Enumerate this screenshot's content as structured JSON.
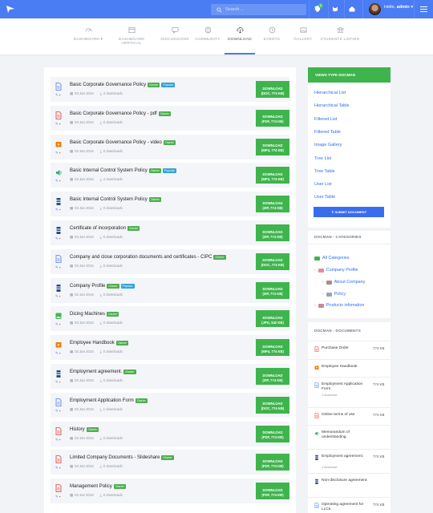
{
  "header": {
    "search_placeholder": "Search ...",
    "notification_count": "1",
    "greeting": "Hello,",
    "username": "admin"
  },
  "nav": [
    {
      "label": "DASHBOARD",
      "icon": "speedometer-icon",
      "active": false
    },
    {
      "label": "DASHBOARD VERTICAL",
      "icon": "layout-icon",
      "active": false
    },
    {
      "label": "DISCUSSIONS",
      "icon": "chat-icon",
      "active": false
    },
    {
      "label": "COMMUNITY",
      "icon": "globe-icon",
      "active": false
    },
    {
      "label": "DOWNLOAD",
      "icon": "cloud-download-icon",
      "active": true
    },
    {
      "label": "EVENTS",
      "icon": "clock-icon",
      "active": false
    },
    {
      "label": "GALLERY",
      "icon": "gallery-icon",
      "active": false
    },
    {
      "label": "STUDENTS LISTING",
      "icon": "bank-icon",
      "active": false
    }
  ],
  "documents": [
    {
      "title": "Basic Corporate Governance Policy",
      "tags": [
        "Owner",
        "Popular"
      ],
      "date": "03 Jan 2016",
      "downloads": "3 downloads",
      "button": [
        "DOWNLOAD",
        "(DOC, 774 KB)"
      ],
      "icon": "doc-icon"
    },
    {
      "title": "Basic Corporate Governance Policy - pdf",
      "tags": [
        "Owner"
      ],
      "date": "03 Jan 2016",
      "downloads": "0 downloads",
      "button": [
        "DOWNLOAD",
        "(PDF, 774 KB)"
      ],
      "icon": "pdf-icon"
    },
    {
      "title": "Basic Corporate Governance Policy - video",
      "tags": [
        "Owner"
      ],
      "date": "03 Jan 2016",
      "downloads": "0 downloads",
      "button": [
        "DOWNLOAD",
        "(MP4, 774 KB)"
      ],
      "icon": "video-icon"
    },
    {
      "title": "Basic Internal Control System Policy",
      "tags": [
        "Owner",
        "Popular"
      ],
      "date": "03 Jan 2016",
      "downloads": "4 downloads",
      "button": [
        "DOWNLOAD",
        "(MP3, 774 KB)"
      ],
      "icon": "audio-icon"
    },
    {
      "title": "Basic Internal Control System Policy",
      "tags": [
        "Owner"
      ],
      "date": "03 Jan 2016",
      "downloads": "0 downloads",
      "button": [
        "DOWNLOAD",
        "(ZIP, 774 KB)"
      ],
      "icon": "zip-icon"
    },
    {
      "title": "Certificate of incorporation",
      "tags": [
        "Owner"
      ],
      "date": "03 Jan 2016",
      "downloads": "0 downloads",
      "button": [
        "DOWNLOAD",
        "(ZIP, 774 KB)"
      ],
      "icon": "zip-icon"
    },
    {
      "title": "Company and close corporation documents and certificates - CIPC",
      "tags": [
        "Owner"
      ],
      "date": "03 Jan 2016",
      "downloads": "0 downloads",
      "button": [
        "DOWNLOAD",
        "(DOC, 774 KB)"
      ],
      "icon": "doc-icon"
    },
    {
      "title": "Company Profile",
      "tags": [
        "Owner",
        "Popular"
      ],
      "date": "03 Jan 2016",
      "downloads": "0 downloads",
      "button": [
        "DOWNLOAD",
        "(ZIP, 774 KB)"
      ],
      "icon": "zip-icon"
    },
    {
      "title": "Dicing Machines",
      "tags": [
        "Owner"
      ],
      "date": "03 Jan 2016",
      "downloads": "0 downloads",
      "button": [
        "DOWNLOAD",
        "(JPG, 542 KB)"
      ],
      "icon": "image-icon"
    },
    {
      "title": "Employee Handbook",
      "tags": [
        "Owner"
      ],
      "date": "03 Jan 2016",
      "downloads": "0 downloads",
      "button": [
        "DOWNLOAD",
        "(MP4, 774 KB)"
      ],
      "icon": "video-icon"
    },
    {
      "title": "Employment agreement.",
      "tags": [
        "Owner"
      ],
      "date": "03 Jan 2016",
      "downloads": "0 downloads",
      "button": [
        "DOWNLOAD",
        "(ZIP, 774 KB)"
      ],
      "icon": "zip-icon"
    },
    {
      "title": "Employment Application Form",
      "tags": [
        "Owner"
      ],
      "date": "03 Jan 2016",
      "downloads": "1 downloads",
      "button": [
        "DOWNLOAD",
        "(DOC, 774 KB)"
      ],
      "icon": "doc-icon"
    },
    {
      "title": "History",
      "tags": [
        "Owner"
      ],
      "date": "03 Jan 2016",
      "downloads": "0 downloads",
      "button": [
        "DOWNLOAD",
        "(PDF, 774 KB)"
      ],
      "icon": "pdf-icon"
    },
    {
      "title": "Limited Company Documents - Slideshare",
      "tags": [
        "Owner"
      ],
      "date": "03 Jan 2016",
      "downloads": "0 downloads",
      "button": [
        "DOWNLOAD",
        "(PDF, 774 KB)"
      ],
      "icon": "pdf-icon"
    },
    {
      "title": "Management Policy",
      "tags": [
        "Owner"
      ],
      "date": "03 Jan 2016",
      "downloads": "0 downloads",
      "button": [
        "DOWNLOAD",
        "(PDF, 774 KB)"
      ],
      "icon": "pdf-icon"
    }
  ],
  "views_box": {
    "title": "VIEWS TYPE DOCMAN",
    "links": [
      "Hierarchical List",
      "Hierarchical Table",
      "Filtered List",
      "Filtered Table",
      "Image Gallery",
      "Tree List",
      "Tree Table",
      "User List",
      "User Table"
    ],
    "submit_label": "SUBMIT DOCUMENT"
  },
  "categories_box": {
    "title": "DOCMAN - CATEGORIES",
    "items": [
      "All Categories",
      "Company Profile",
      "About Company",
      "Policy",
      "Products infomation"
    ]
  },
  "documents_box": {
    "title": "DOCMAN - DOCUMENTS",
    "items": [
      {
        "name": "Purchase Order",
        "size": "774 KB",
        "downloads": "",
        "icon": "pdf-icon"
      },
      {
        "name": "Employee Handbook",
        "size": "",
        "downloads": "",
        "icon": "video-icon"
      },
      {
        "name": "Employment Application Form",
        "size": "774 KB",
        "downloads": "1 download",
        "icon": "doc-icon"
      },
      {
        "name": "Online terms of use",
        "size": "774 KB",
        "downloads": "",
        "icon": "pdf-icon"
      },
      {
        "name": "Memorandum of understanding.",
        "size": "",
        "downloads": "",
        "icon": "audio-icon"
      },
      {
        "name": "Employment agreement.",
        "size": "774 KB",
        "downloads": "1 download",
        "icon": "zip-icon"
      },
      {
        "name": "Non-disclosure agreement.",
        "size": "",
        "downloads": "",
        "icon": "zip-icon"
      },
      {
        "name": "Operating agreement for LLCs.",
        "size": "774 KB",
        "downloads": "",
        "icon": "doc-icon"
      }
    ]
  },
  "colors": {
    "primary": "#4a7cf3",
    "success": "#3fb44d",
    "info": "#2fa4d7",
    "danger": "#e53935"
  }
}
